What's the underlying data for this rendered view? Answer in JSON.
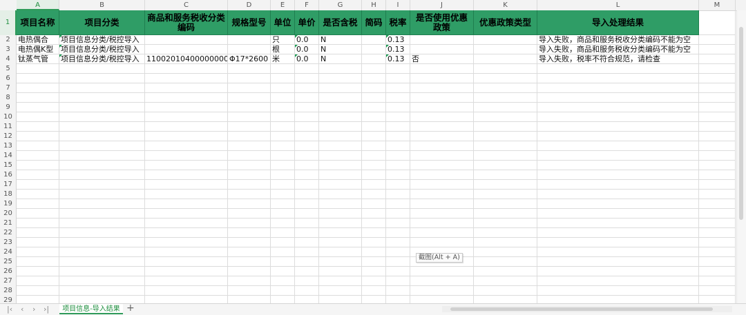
{
  "columns": [
    "A",
    "B",
    "C",
    "D",
    "E",
    "F",
    "G",
    "H",
    "I",
    "J",
    "K",
    "L",
    "M"
  ],
  "selected_column": "A",
  "selected_row": "1",
  "row_numbers": [
    "1",
    "2",
    "3",
    "4",
    "5",
    "6",
    "7",
    "8",
    "9",
    "10",
    "11",
    "12",
    "13",
    "14",
    "15",
    "16",
    "17",
    "18",
    "19",
    "20",
    "21",
    "22",
    "23",
    "24",
    "25",
    "26",
    "27",
    "28",
    "29"
  ],
  "header_row": [
    "项目名称",
    "项目分类",
    "商品和服务税收分类编码",
    "规格型号",
    "单位",
    "单价",
    "是否含税",
    "简码",
    "税率",
    "是否使用优惠政策",
    "优惠政策类型",
    "导入处理结果"
  ],
  "data_rows": [
    [
      "电热偶合",
      "项目信息分类/税控导入",
      "",
      "",
      "只",
      "0.0",
      "N",
      "",
      "0.13",
      "",
      "",
      "导入失败，商品和服务税收分类编码不能为空"
    ],
    [
      "电热偶K型",
      "项目信息分类/税控导入",
      "",
      "",
      "根",
      "0.0",
      "N",
      "",
      "0.13",
      "",
      "",
      "导入失败，商品和服务税收分类编码不能为空"
    ],
    [
      "钛蒸气管",
      "项目信息分类/税控导入",
      "1100201040000000000",
      "Φ17*2600",
      "米",
      "0.0",
      "N",
      "",
      "0.13",
      "否",
      "",
      "导入失败，税率不符合规范，请检查"
    ]
  ],
  "sheet_tab": "项目信息-导入结果",
  "add_sheet_icon": "plus-icon",
  "tooltip": "截图(Alt + A)",
  "colors": {
    "header_fill": "#2f9d66",
    "accent": "#1e8e3e"
  }
}
